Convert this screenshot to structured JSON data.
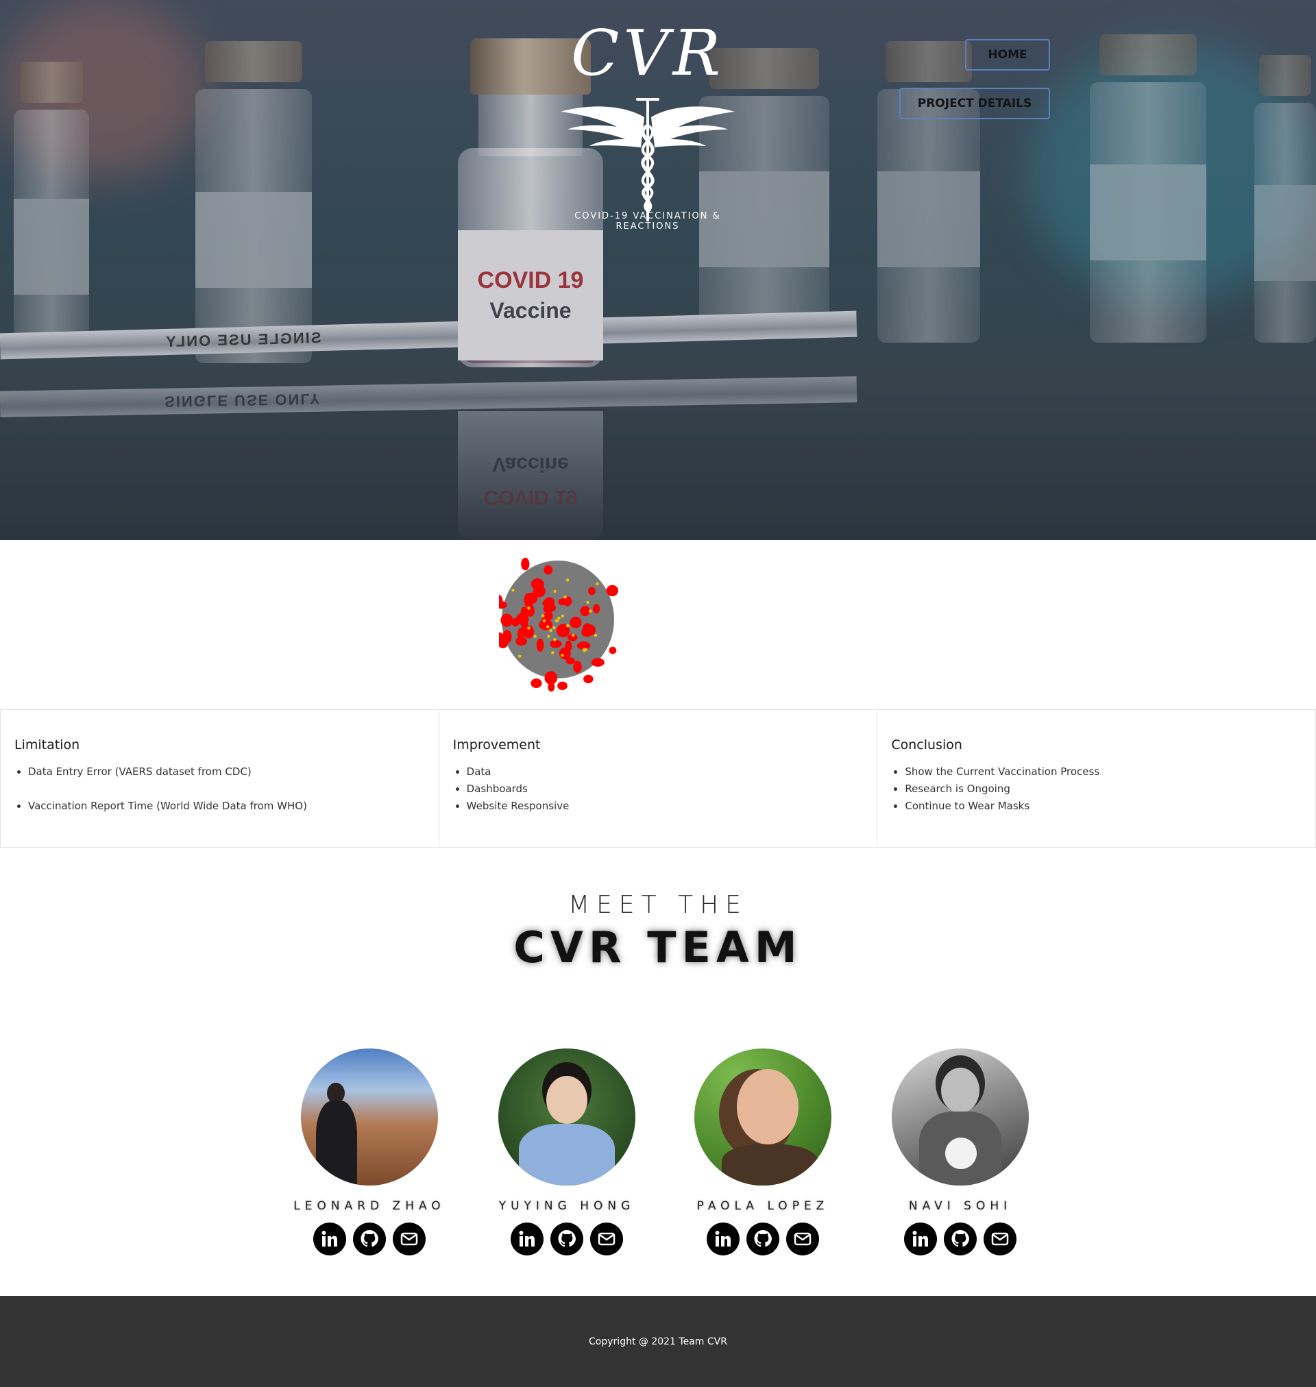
{
  "hero": {
    "vial_label_line1": "COVID 19",
    "vial_label_line2": "Vaccine",
    "syringe_text": "SINGLE USE ONLY"
  },
  "logo": {
    "mark": "CVR",
    "tagline": "COVID-19 VACCINATION & REACTIONS"
  },
  "nav": {
    "home": "HOME",
    "project_details": "PROJECT DETAILS"
  },
  "panels": [
    {
      "title": "Limitation",
      "items": [
        "Data Entry Error (VAERS dataset from CDC)",
        "Vaccination Report Time (World Wide Data from WHO)"
      ]
    },
    {
      "title": "Improvement",
      "items": [
        "Data",
        "Dashboards",
        "Website Responsive"
      ]
    },
    {
      "title": "Conclusion",
      "items": [
        "Show the Current Vaccination Process",
        "Research is Ongoing",
        "Continue to Wear Masks"
      ]
    }
  ],
  "team": {
    "meet": "MEET THE",
    "title": "CVR TEAM",
    "members": [
      {
        "name": "LEONARD ZHAO",
        "icons": [
          "linkedin-icon",
          "github-icon",
          "email-icon"
        ]
      },
      {
        "name": "YUYING HONG",
        "icons": [
          "linkedin-icon",
          "github-icon",
          "email-icon"
        ]
      },
      {
        "name": "PAOLA LOPEZ",
        "icons": [
          "linkedin-icon",
          "github-icon",
          "email-icon"
        ]
      },
      {
        "name": "NAVI SOHI",
        "icons": [
          "linkedin-icon",
          "github-icon",
          "email-icon"
        ]
      }
    ]
  },
  "footer": {
    "copyright": "Copyright @ 2021 Team CVR"
  },
  "colors": {
    "nav_border": "#5d7fc2",
    "footer_bg": "#333333",
    "virus_core": "#7a7a7a",
    "virus_spike": "#ff0000",
    "virus_dot": "#f5c400"
  }
}
